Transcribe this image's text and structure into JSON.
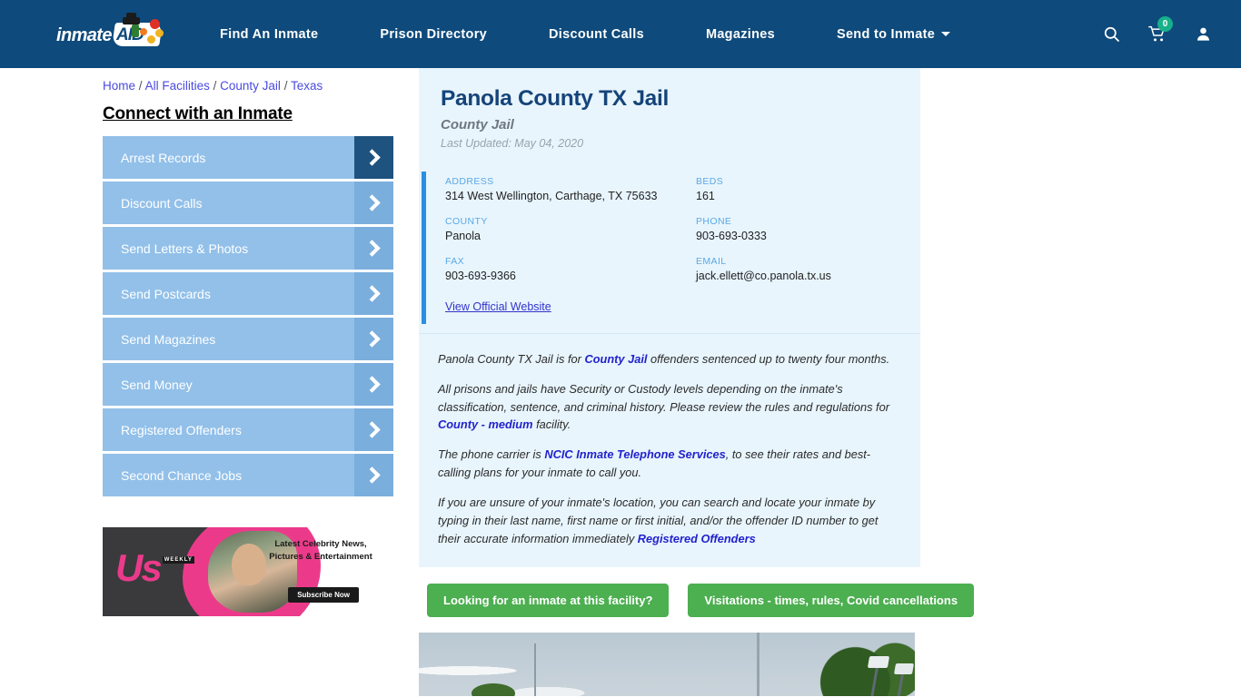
{
  "navbar": {
    "logo_text": "inmate",
    "logo_accent": "AID",
    "logo_icon": "inmateaid-logo",
    "links": [
      {
        "label": "Find An Inmate",
        "dropdown": false
      },
      {
        "label": "Prison Directory",
        "dropdown": false
      },
      {
        "label": "Discount Calls",
        "dropdown": false
      },
      {
        "label": "Magazines",
        "dropdown": false
      },
      {
        "label": "Send to Inmate",
        "dropdown": true
      }
    ],
    "search_icon": "search-icon",
    "cart_icon": "shopping-cart-icon",
    "cart_count": "0",
    "account_icon": "user-account-icon",
    "background_color": "#0e4a7b",
    "badge_color": "#17b08a"
  },
  "breadcrumb": {
    "items": [
      "Home",
      "All Facilities",
      "County Jail",
      "Texas"
    ],
    "separator": "/"
  },
  "sidebar": {
    "title": "Connect with an Inmate",
    "items": [
      {
        "label": "Arrest Records",
        "active": true
      },
      {
        "label": "Discount Calls",
        "active": false
      },
      {
        "label": "Send Letters & Photos",
        "active": false
      },
      {
        "label": "Send Postcards",
        "active": false
      },
      {
        "label": "Send Magazines",
        "active": false
      },
      {
        "label": "Send Money",
        "active": false
      },
      {
        "label": "Registered Offenders",
        "active": false
      },
      {
        "label": "Second Chance Jobs",
        "active": false
      }
    ],
    "item_color": "#92c0e9",
    "arrow_color": "#7aaedd",
    "active_arrow_color": "#1e527f"
  },
  "ad": {
    "brand": "Us",
    "brand_suffix": "WEEKLY",
    "headline": "Latest Celebrity News, Pictures & Entertainment",
    "cta": "Subscribe Now"
  },
  "facility": {
    "name": "Panola County TX Jail",
    "type": "County Jail",
    "last_updated": "Last Updated: May 04, 2020",
    "fields_left": [
      {
        "label": "ADDRESS",
        "value": "314 West Wellington, Carthage, TX 75633"
      },
      {
        "label": "COUNTY",
        "value": "Panola"
      },
      {
        "label": "FAX",
        "value": "903-693-9366"
      }
    ],
    "fields_right": [
      {
        "label": "BEDS",
        "value": "161"
      },
      {
        "label": "PHONE",
        "value": "903-693-0333"
      },
      {
        "label": "EMAIL",
        "value": "jack.ellett@co.panola.tx.us"
      }
    ],
    "official_website_link": "View Official Website",
    "accent_color": "#2a8fe0",
    "panel_color": "#e8f5fd",
    "title_color": "#15447a"
  },
  "description": {
    "p1_a": "Panola County TX Jail is for ",
    "p1_link": "County Jail",
    "p1_b": " offenders sentenced up to twenty four months.",
    "p2_a": "All prisons and jails have Security or Custody levels depending on the inmate's classification, sentence, and criminal history. Please review the rules and regulations for ",
    "p2_link": "County - medium",
    "p2_b": " facility.",
    "p3_a": "The phone carrier is ",
    "p3_link": "NCIC Inmate Telephone Services",
    "p3_b": ", to see their rates and best-calling plans for your inmate to call you.",
    "p4_a": "If you are unsure of your inmate's location, you can search and locate your inmate by typing in their last name, first name or first initial, and/or the offender ID number to get their accurate information immediately ",
    "p4_link": "Registered Offenders"
  },
  "cta_buttons": [
    {
      "label": "Looking for an inmate at this facility?"
    },
    {
      "label": "Visitations - times, rules, Covid cancellations"
    }
  ],
  "facility_photo": {
    "alt": "facility-street-view-photo"
  }
}
